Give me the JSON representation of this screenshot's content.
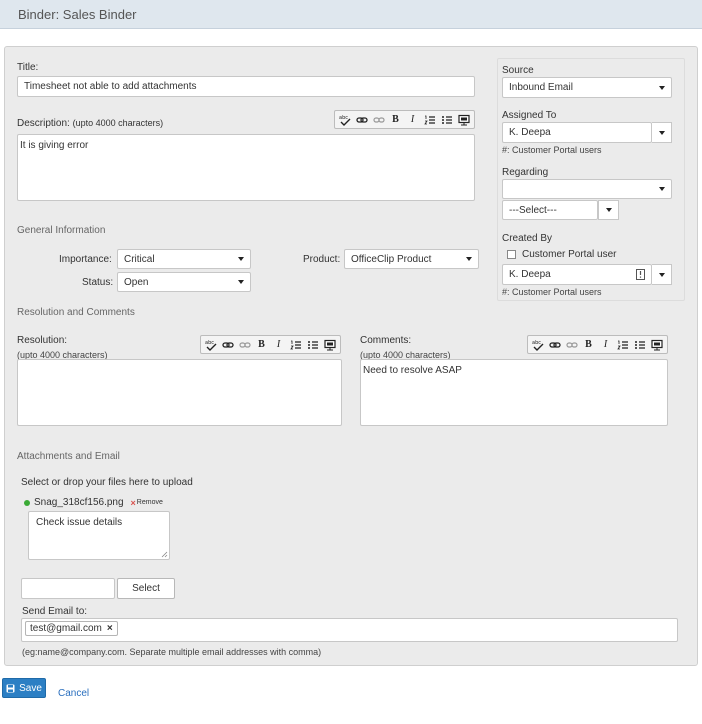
{
  "header": {
    "title": "Binder: Sales Binder"
  },
  "form": {
    "title_label": "Title:",
    "title_value": "Timesheet not able to add attachments",
    "description_label": "Description:",
    "description_hint": "(upto 4000 characters)",
    "description_value": "It is giving error",
    "general_info_heading": "General Information",
    "importance_label": "Importance:",
    "importance_value": "Critical",
    "status_label": "Status:",
    "status_value": "Open",
    "product_label": "Product:",
    "product_value": "OfficeClip Product",
    "resolution_heading": "Resolution and Comments",
    "resolution_label": "Resolution:",
    "resolution_hint": "(upto 4000 characters)",
    "resolution_value": "",
    "comments_label": "Comments:",
    "comments_hint": "(upto 4000 characters)",
    "comments_value": "Need to resolve ASAP",
    "attachments_heading": "Attachments and Email",
    "upload_prompt": "Select or drop your files here to upload",
    "attachment_filename": "Snag_318cf156.png",
    "attachment_remove": "Remove",
    "attachment_remove_glyph": "×",
    "attachment_note": "Check issue details",
    "file_input_value": "",
    "select_button": "Select",
    "send_email_label": "Send Email to:",
    "email_chip": "test@gmail.com",
    "email_chip_remove": "×",
    "email_hint": "(eg:name@company.com. Separate multiple email addresses with comma)"
  },
  "sidebar": {
    "source_label": "Source",
    "source_value": "Inbound Email",
    "assigned_to_label": "Assigned To",
    "assigned_to_value": "K. Deepa",
    "assigned_hint": "#: Customer Portal users",
    "regarding_label": "Regarding",
    "regarding_value": "",
    "regarding_sub_value": "---Select---",
    "created_by_label": "Created By",
    "customer_portal_label": "Customer Portal user",
    "created_by_value": "K. Deepa",
    "created_hint": "#: Customer Portal users"
  },
  "actions": {
    "save": "Save",
    "cancel": "Cancel"
  },
  "icons": {
    "toolbar": [
      "spellcheck-icon",
      "link-icon",
      "unlink-icon",
      "bold-icon",
      "italic-icon",
      "ordered-list-icon",
      "bullet-list-icon",
      "source-view-icon"
    ],
    "bold_glyph": "B",
    "italic_glyph": "I"
  },
  "colors": {
    "accent": "#2c7fc4",
    "panel": "#ebebeb",
    "header": "#dfe7ee",
    "attachment_dot": "#3aaa35"
  }
}
